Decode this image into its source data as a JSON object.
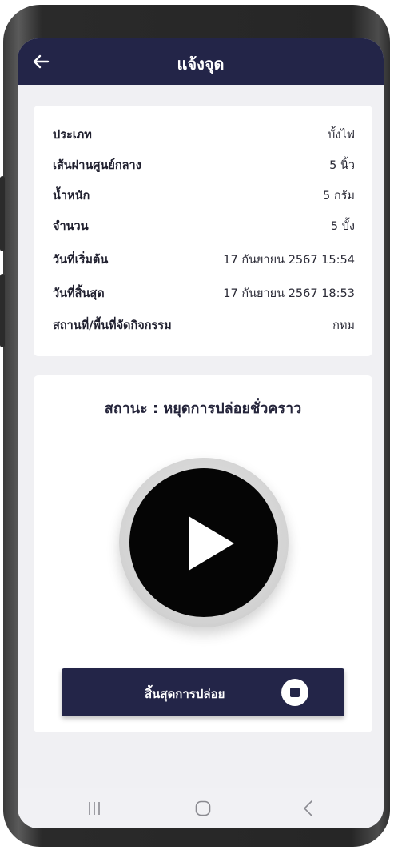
{
  "header": {
    "title": "แจ้งจุด",
    "back_icon": "arrow-left-icon"
  },
  "info": {
    "rows": [
      {
        "label": "ประเภท",
        "value": "บั้งไฟ"
      },
      {
        "label": "เส้นผ่านศูนย์กลาง",
        "value": "5 นิ้ว"
      },
      {
        "label": "น้ำหนัก",
        "value": "5 กรัม"
      },
      {
        "label": "จำนวน",
        "value": "5 บั้ง"
      },
      {
        "label": "วันที่เริ่มต้น",
        "value": "17 กันยายน 2567 15:54"
      },
      {
        "label": "วันที่สิ้นสุด",
        "value": "17 กันยายน 2567 18:53"
      },
      {
        "label": "สถานที่/พื้นที่จัดกิจกรรม",
        "value": "กทม"
      }
    ]
  },
  "status": {
    "text": "สถานะ : หยุดการปล่อยชั่วคราว",
    "play_icon": "play-icon"
  },
  "end_button": {
    "label": "สิ้นสุดการปล่อย",
    "icon": "stop-icon"
  },
  "navbar": {
    "icons": [
      "recent-apps-icon",
      "home-icon",
      "back-icon"
    ]
  },
  "colors": {
    "primary": "#232548",
    "screen_bg": "#f0f0f3",
    "card_bg": "#ffffff",
    "play_button": "#050505"
  }
}
